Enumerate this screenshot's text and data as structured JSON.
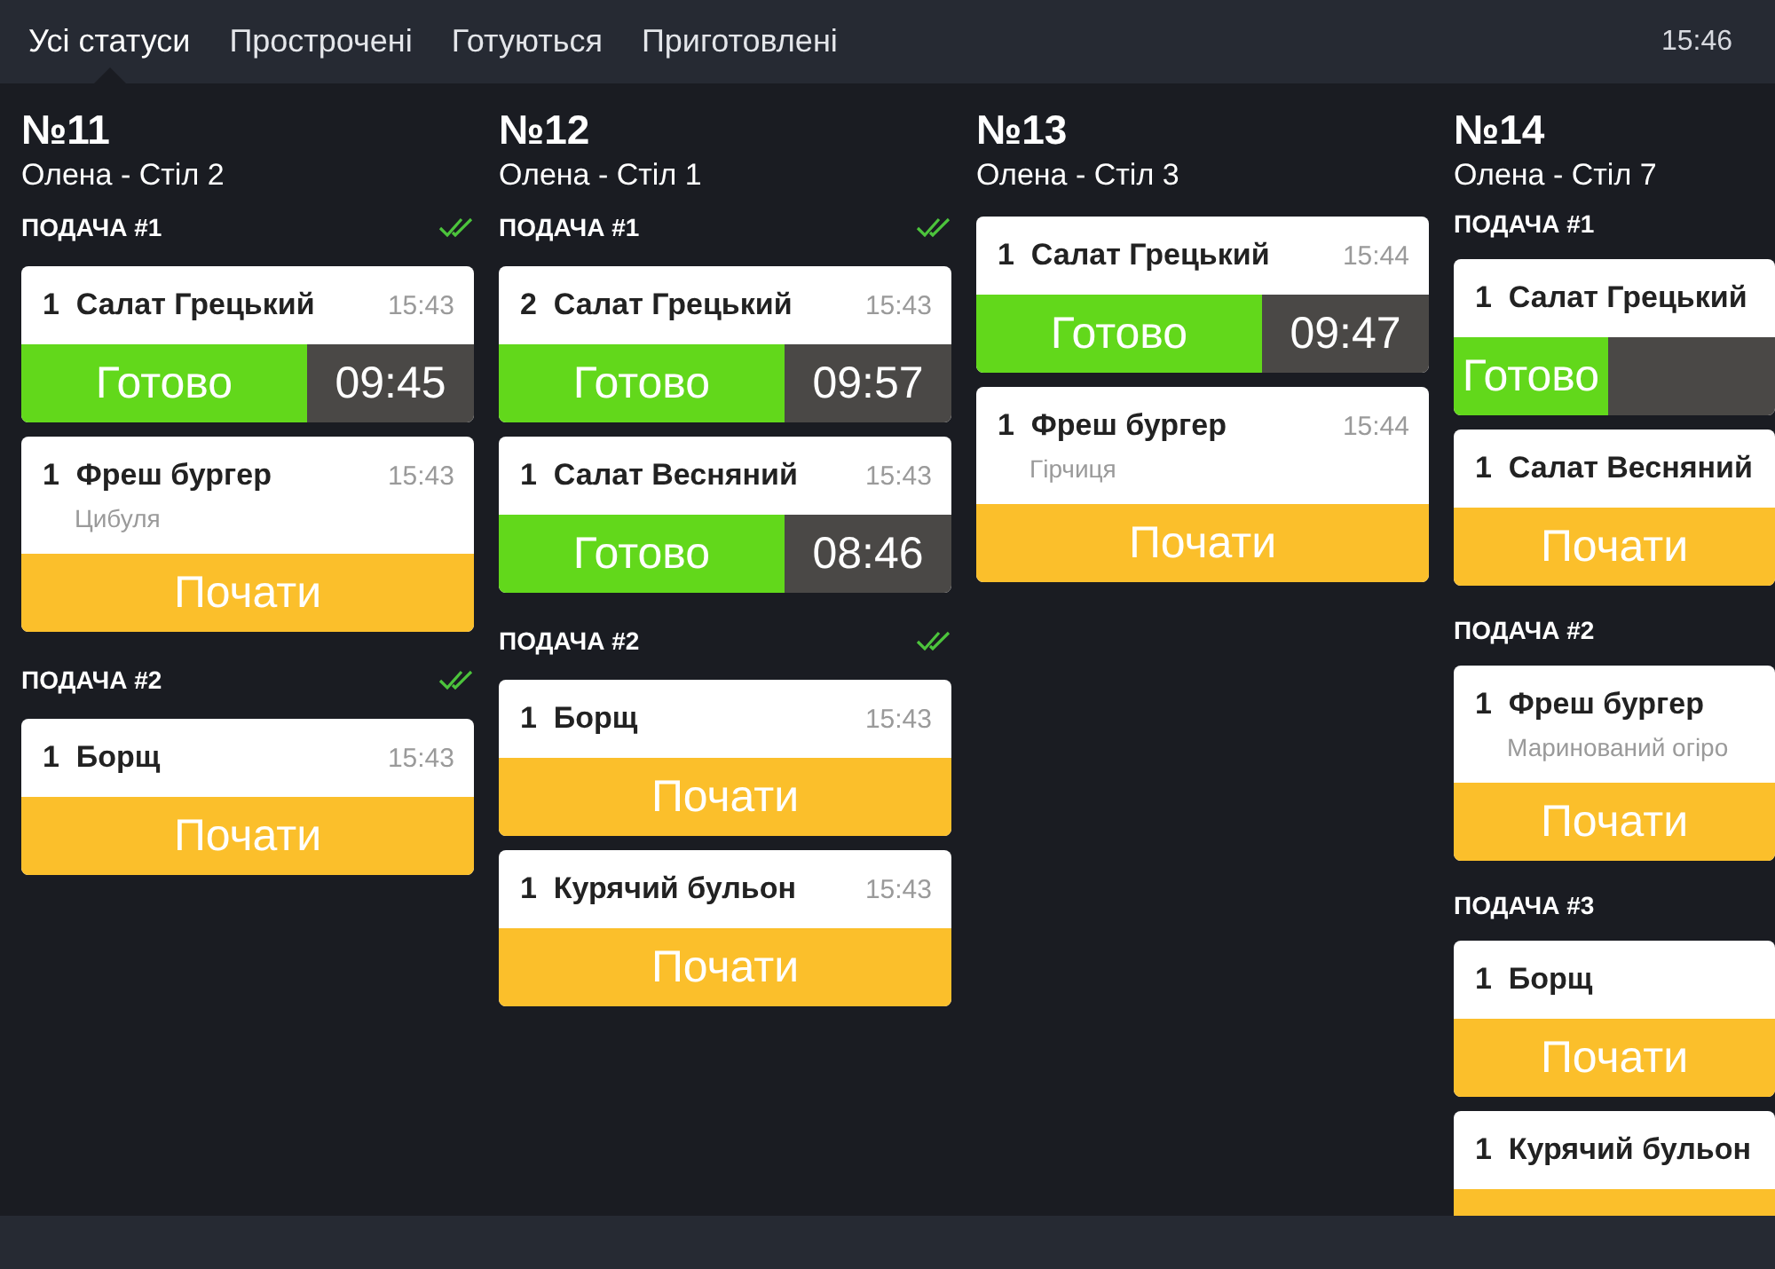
{
  "tabs": [
    {
      "label": "Усі статуси",
      "selected": true
    },
    {
      "label": "Прострочені",
      "selected": false
    },
    {
      "label": "Готуються",
      "selected": false
    },
    {
      "label": "Приготовлені",
      "selected": false
    }
  ],
  "clock": "15:46",
  "orders": [
    {
      "number": "№11",
      "subtitle": "Олена - Стіл 2",
      "courses": [
        {
          "title": "ПОДАЧА #1",
          "done": true,
          "items": [
            {
              "qty": "1",
              "name": "Салат Грецький",
              "time": "15:43",
              "action": {
                "kind": "ready",
                "label": "Готово",
                "timer": "09:45"
              }
            },
            {
              "qty": "1",
              "name": "Фреш бургер",
              "time": "15:43",
              "note": "Цибуля",
              "action": {
                "kind": "start",
                "label": "Почати"
              }
            }
          ]
        },
        {
          "title": "ПОДАЧА #2",
          "done": true,
          "items": [
            {
              "qty": "1",
              "name": "Борщ",
              "time": "15:43",
              "action": {
                "kind": "start",
                "label": "Почати"
              }
            }
          ]
        }
      ]
    },
    {
      "number": "№12",
      "subtitle": "Олена - Стіл 1",
      "courses": [
        {
          "title": "ПОДАЧА #1",
          "done": true,
          "items": [
            {
              "qty": "2",
              "name": "Салат Грецький",
              "time": "15:43",
              "action": {
                "kind": "ready",
                "label": "Готово",
                "timer": "09:57"
              }
            },
            {
              "qty": "1",
              "name": "Салат Весняний",
              "time": "15:43",
              "action": {
                "kind": "ready",
                "label": "Готово",
                "timer": "08:46"
              }
            }
          ]
        },
        {
          "title": "ПОДАЧА #2",
          "done": true,
          "items": [
            {
              "qty": "1",
              "name": "Борщ",
              "time": "15:43",
              "action": {
                "kind": "start",
                "label": "Почати"
              }
            },
            {
              "qty": "1",
              "name": "Курячий бульон",
              "time": "15:43",
              "action": {
                "kind": "start",
                "label": "Почати"
              }
            }
          ]
        }
      ]
    },
    {
      "number": "№13",
      "subtitle": "Олена - Стіл 3",
      "courses": [
        {
          "items": [
            {
              "qty": "1",
              "name": "Салат Грецький",
              "time": "15:44",
              "action": {
                "kind": "ready",
                "label": "Готово",
                "timer": "09:47"
              }
            },
            {
              "qty": "1",
              "name": "Фреш бургер",
              "time": "15:44",
              "note": "Гірчиця",
              "action": {
                "kind": "start",
                "label": "Почати"
              }
            }
          ]
        }
      ]
    },
    {
      "number": "№14",
      "subtitle": "Олена - Стіл 7",
      "courses": [
        {
          "title": "ПОДАЧА #1",
          "done": false,
          "items": [
            {
              "qty": "1",
              "name": "Салат Грецький",
              "action": {
                "kind": "ready",
                "label": "Готово"
              }
            },
            {
              "qty": "1",
              "name": "Салат Весняний",
              "action": {
                "kind": "start",
                "label": "Почати"
              }
            }
          ]
        },
        {
          "title": "ПОДАЧА #2",
          "done": false,
          "items": [
            {
              "qty": "1",
              "name": "Фреш бургер",
              "note": "Маринований огіро",
              "action": {
                "kind": "start",
                "label": "Почати"
              }
            }
          ]
        },
        {
          "title": "ПОДАЧА #3",
          "done": false,
          "items": [
            {
              "qty": "1",
              "name": "Борщ",
              "action": {
                "kind": "start",
                "label": "Почати"
              }
            },
            {
              "qty": "1",
              "name": "Курячий бульон",
              "action": {
                "kind": "start"
              }
            }
          ]
        }
      ]
    }
  ]
}
